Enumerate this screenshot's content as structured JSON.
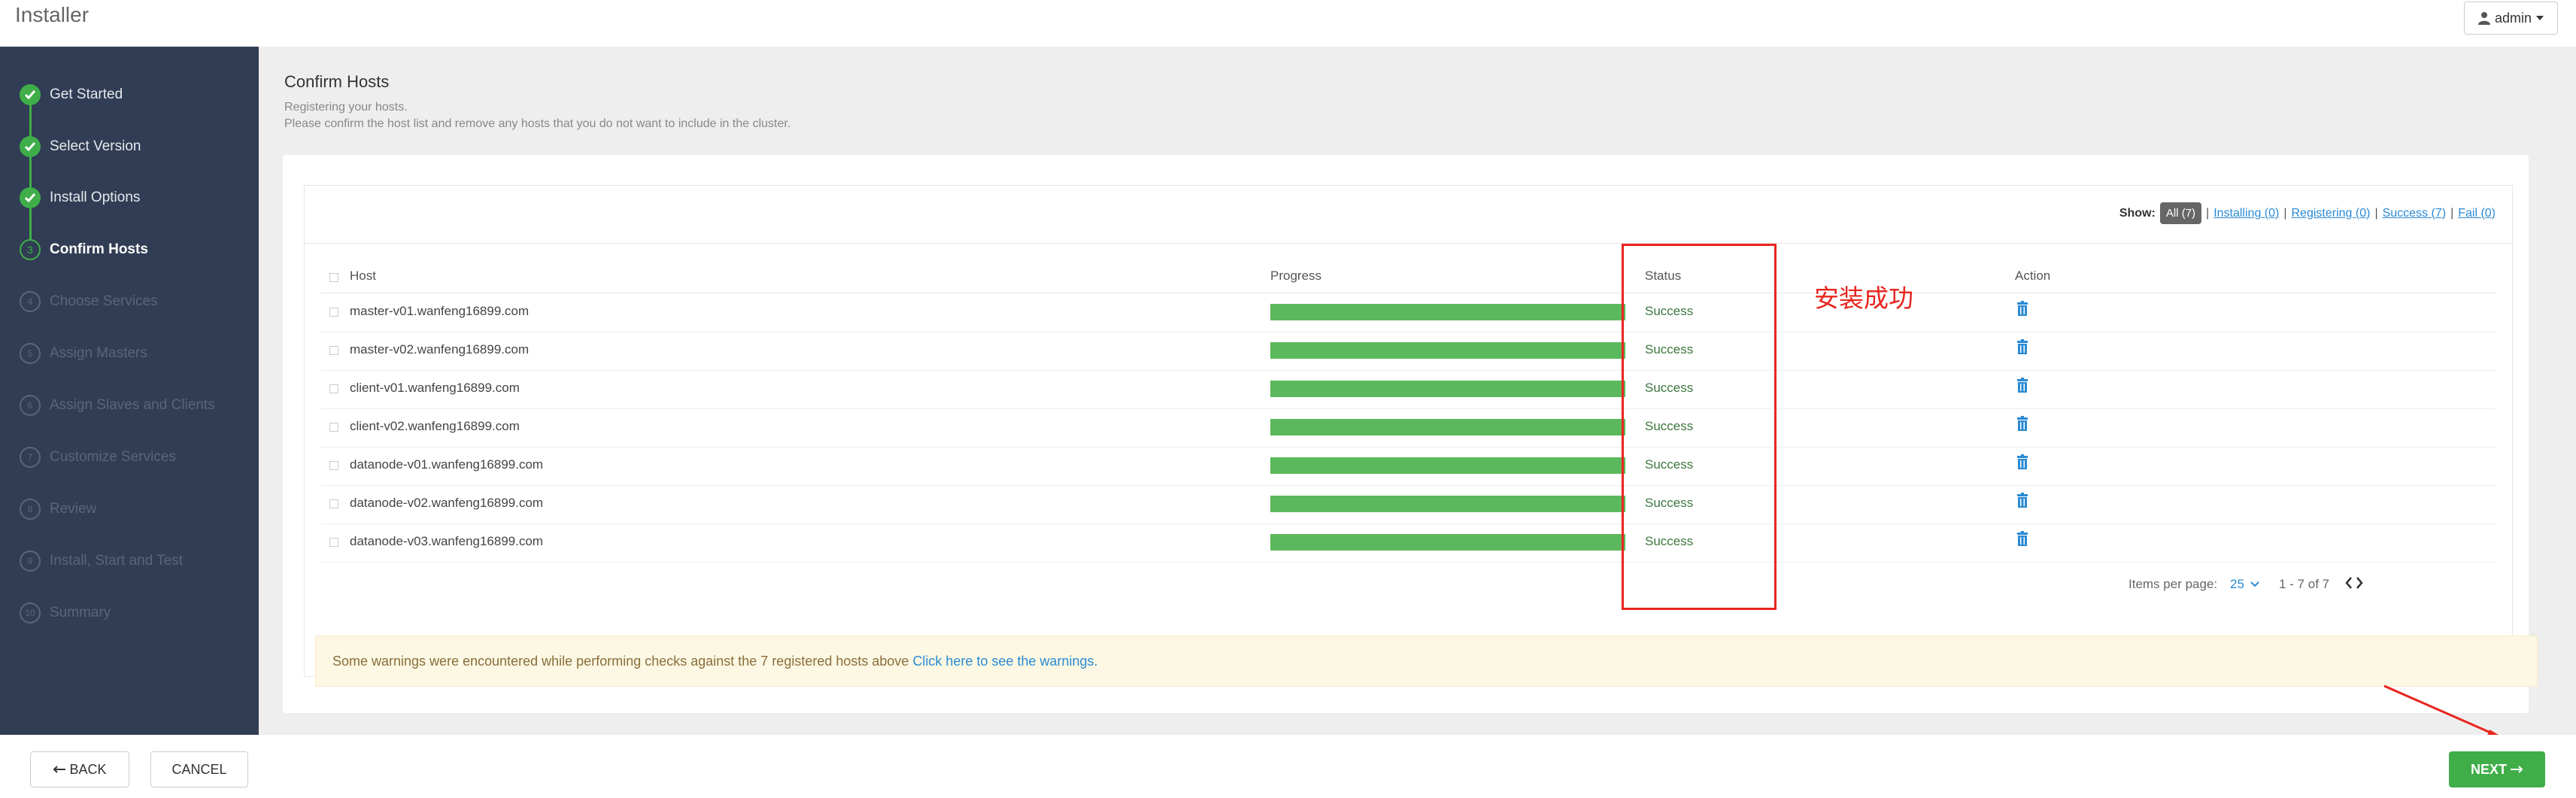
{
  "app": {
    "title": "Installer",
    "user_label": "admin"
  },
  "sidebar": {
    "steps": [
      {
        "num": "1",
        "label": "Get Started",
        "state": "done"
      },
      {
        "num": "2",
        "label": "Select Version",
        "state": "done"
      },
      {
        "num": "3",
        "label": "Install Options",
        "state": "done"
      },
      {
        "num": "3",
        "label": "Confirm Hosts",
        "state": "current"
      },
      {
        "num": "4",
        "label": "Choose Services",
        "state": "pending"
      },
      {
        "num": "5",
        "label": "Assign Masters",
        "state": "pending"
      },
      {
        "num": "6",
        "label": "Assign Slaves and Clients",
        "state": "pending"
      },
      {
        "num": "7",
        "label": "Customize Services",
        "state": "pending"
      },
      {
        "num": "8",
        "label": "Review",
        "state": "pending"
      },
      {
        "num": "9",
        "label": "Install, Start and Test",
        "state": "pending"
      },
      {
        "num": "10",
        "label": "Summary",
        "state": "pending"
      }
    ]
  },
  "page": {
    "title": "Confirm Hosts",
    "subtitle1": "Registering your hosts.",
    "subtitle2": "Please confirm the host list and remove any hosts that you do not want to include in the cluster."
  },
  "filter": {
    "show_label": "Show:",
    "all": "All (7)",
    "sep": "|",
    "installing": "Installing (0)",
    "registering": "Registering (0)",
    "success": "Success (7)",
    "fail": "Fail (0)"
  },
  "table": {
    "headers": {
      "host": "Host",
      "progress": "Progress",
      "status": "Status",
      "action": "Action"
    },
    "rows": [
      {
        "host": "master-v01.wanfeng16899.com",
        "progress": 1.0,
        "status": "Success"
      },
      {
        "host": "master-v02.wanfeng16899.com",
        "progress": 1.0,
        "status": "Success"
      },
      {
        "host": "client-v01.wanfeng16899.com",
        "progress": 1.0,
        "status": "Success"
      },
      {
        "host": "client-v02.wanfeng16899.com",
        "progress": 1.0,
        "status": "Success"
      },
      {
        "host": "datanode-v01.wanfeng16899.com",
        "progress": 1.0,
        "status": "Success"
      },
      {
        "host": "datanode-v02.wanfeng16899.com",
        "progress": 1.0,
        "status": "Success"
      },
      {
        "host": "datanode-v03.wanfeng16899.com",
        "progress": 1.0,
        "status": "Success"
      }
    ],
    "items_per_page_label": "Items per page:",
    "items_per_page_value": "25",
    "range": "1 - 7 of 7"
  },
  "warning": {
    "text": "Some warnings were encountered while performing checks against the 7 registered hosts above",
    "link": "Click here to see the warnings."
  },
  "annotation": {
    "text": "安装成功",
    "color": "#e8251f"
  },
  "footer": {
    "back": "BACK",
    "cancel": "CANCEL",
    "next": "NEXT"
  },
  "colors": {
    "sidebar": "#313d54",
    "accent": "#3fae49",
    "progress": "#5cb85c",
    "link": "#2a8ad3"
  }
}
